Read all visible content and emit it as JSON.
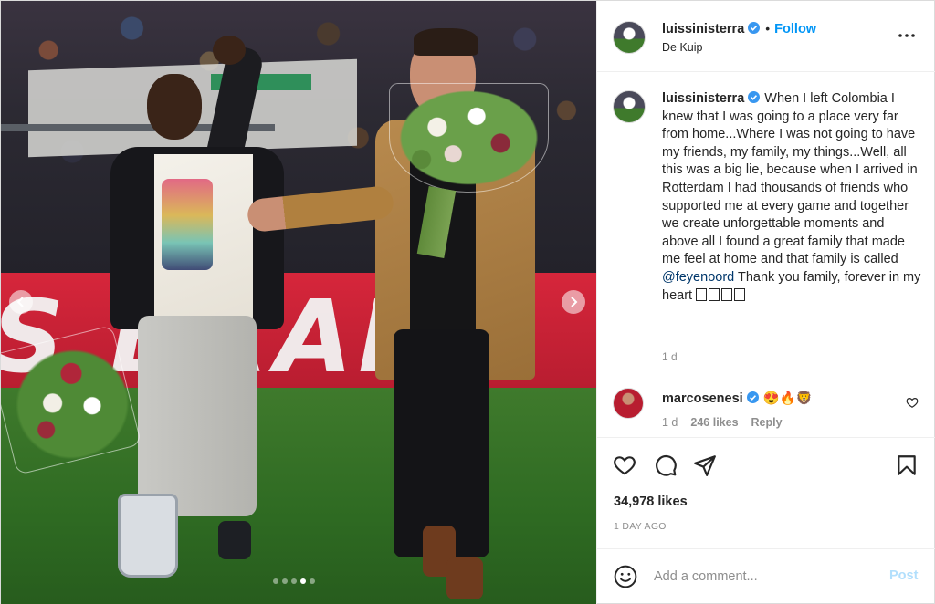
{
  "photo": {
    "ad_text": "S BRAM"
  },
  "post": {
    "username": "luissinisterra",
    "separator": "•",
    "follow_label": "Follow",
    "location": "De Kuip",
    "caption": {
      "username": "luissinisterra",
      "text_before_mention": "When I left Colombia I knew that I was going to a place very far from home...Where I was not going to have my friends, my family, my things...Well, all this was a big lie, because when I arrived in Rotterdam I had thousands of friends who supported me at every game and together we create unforgettable moments and above all I found a great family that made me feel at home and that family is called",
      "mention": "@feyenoord",
      "text_after_mention": "Thank you family, forever in my heart",
      "time": "1 d"
    },
    "comment": {
      "username": "marcosenesi",
      "emojis": "😍🔥🦁",
      "time": "1 d",
      "likes": "246 likes",
      "reply_label": "Reply"
    },
    "likes_count": "34,978 likes",
    "date": "1 DAY AGO",
    "add_comment_placeholder": "Add a comment...",
    "post_label": "Post"
  },
  "colors": {
    "link_blue": "#0095f6",
    "mention_blue": "#00376b",
    "muted": "#8e8e8e",
    "post_disabled": "#b2dffc",
    "ad_red": "#d6263b"
  },
  "icons": [
    "chevron-left-icon",
    "chevron-right-icon",
    "verified-badge-icon",
    "more-options-icon",
    "heart-icon",
    "comment-icon",
    "share-icon",
    "bookmark-icon",
    "emoji-icon",
    "small-heart-icon"
  ]
}
